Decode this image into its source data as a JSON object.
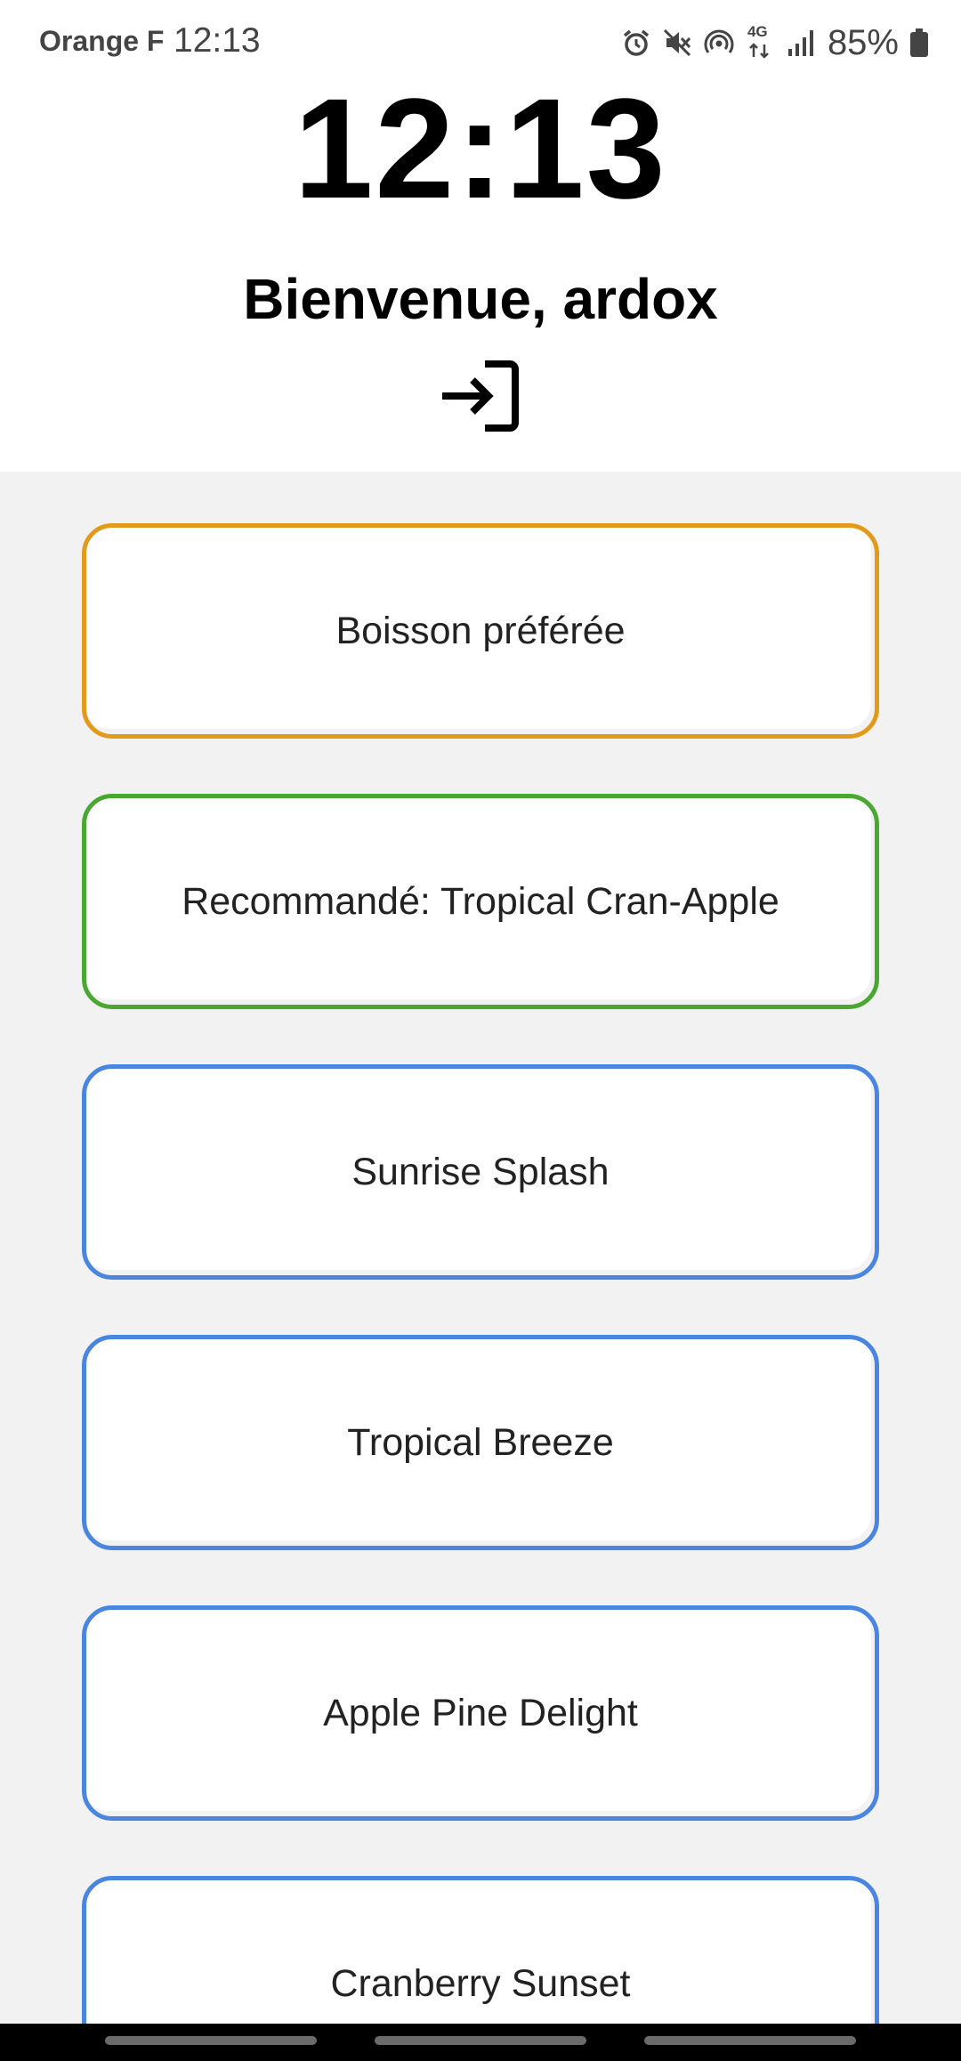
{
  "status_bar": {
    "carrier": "Orange F",
    "time": "12:13",
    "icons": [
      "alarm-icon",
      "mute-icon",
      "hotspot-icon",
      "network-4g-icon",
      "signal-icon",
      "battery-icon"
    ],
    "network_label": "4G",
    "battery": "85%"
  },
  "header": {
    "clock": "12:13",
    "welcome": "Bienvenue, ardox",
    "login_icon": "login-arrow-icon"
  },
  "cards": [
    {
      "label": "Boisson préférée",
      "border_color": "#e29a1c"
    },
    {
      "label": "Recommandé: Tropical Cran-Apple",
      "border_color": "#4aa832"
    },
    {
      "label": "Sunrise Splash",
      "border_color": "#4a86e0"
    },
    {
      "label": "Tropical Breeze",
      "border_color": "#4a86e0"
    },
    {
      "label": "Apple Pine Delight",
      "border_color": "#4a86e0"
    },
    {
      "label": "Cranberry Sunset",
      "border_color": "#4a86e0"
    }
  ],
  "colors": {
    "header_bg": "#ffffff",
    "page_bg": "#f2f2f2",
    "favorite_border": "#e29a1c",
    "recommended_border": "#4aa832",
    "drink_border": "#4a86e0"
  }
}
